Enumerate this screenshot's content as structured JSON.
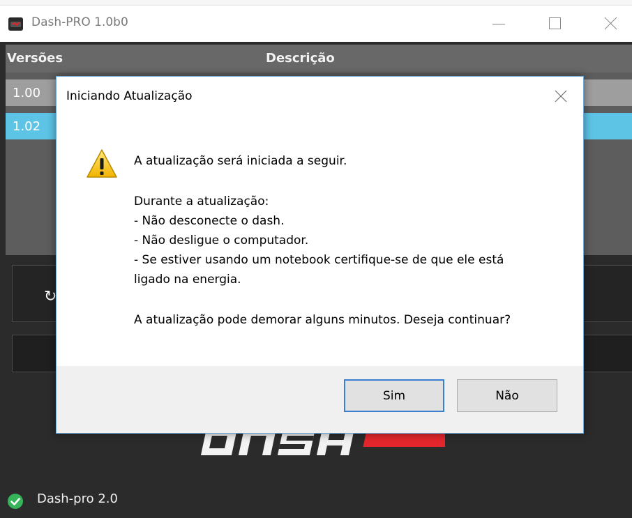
{
  "window": {
    "title": "Dash-PRO 1.0b0"
  },
  "table": {
    "columns": [
      "Versões",
      "Descrição"
    ],
    "rows": [
      {
        "version": "1.00"
      },
      {
        "version": "1.02"
      }
    ],
    "selected_row_color": "#5ec4e6"
  },
  "footer": {
    "logo_text": "DASH PRO",
    "status_text": "Dash-pro 2.0",
    "status_icon": "check-circle-icon"
  },
  "dialog": {
    "title": "Iniciando Atualização",
    "icon": "warning-icon",
    "lines": [
      "A atualização será iniciada a seguir.",
      "Durante a atualização:",
      "- Não desconecte o dash.",
      "- Não desligue o computador.",
      "- Se estiver usando um notebook certifique-se de que ele está",
      "ligado na energia.",
      "A atualização pode demorar alguns minutos. Deseja continuar?"
    ],
    "buttons": {
      "yes": "Sim",
      "no": "Não"
    }
  }
}
